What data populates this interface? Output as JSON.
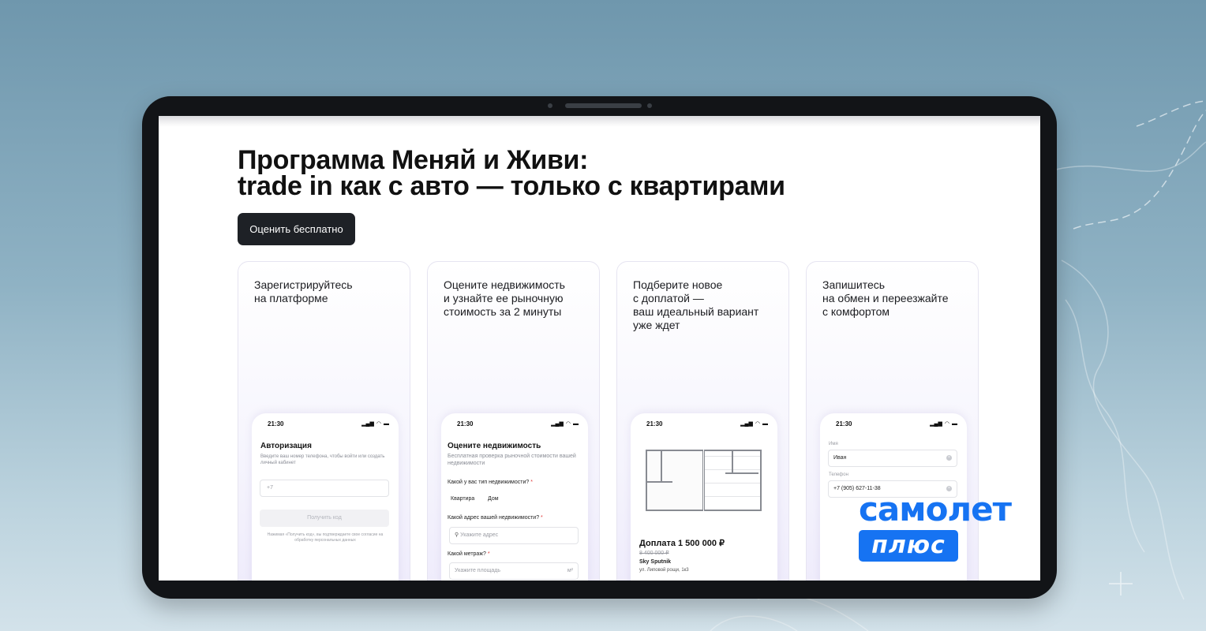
{
  "page": {
    "title_line1": "Программа Меняй и Живи:",
    "title_line2": "trade in как с авто — только с квартирами",
    "cta_label": "Оценить бесплатно"
  },
  "cards": [
    {
      "lines": [
        "Зарегистрируйтесь",
        "на платформе"
      ]
    },
    {
      "lines": [
        "Оцените недвижимость",
        "и узнайте ее рыночную",
        "стоимость за 2 минуты"
      ]
    },
    {
      "lines": [
        "Подберите новое",
        "с доплатой —",
        "ваш идеальный вариант",
        "уже ждет"
      ]
    },
    {
      "lines": [
        "Запишитесь",
        "на обмен и переезжайте",
        "с комфортом"
      ]
    }
  ],
  "phone_time": "21:30",
  "status_icons": [
    "signal-icon",
    "wifi-icon",
    "battery-icon"
  ],
  "phone1": {
    "heading": "Авторизация",
    "subtitle": "Введите ваш номер телефона, чтобы войти или создать личный кабинет",
    "phone_placeholder": "+7",
    "button": "Получить код",
    "legal": "Нажимая «Получить код», вы подтверждаете свое согласие на обработку персональных данных"
  },
  "phone2": {
    "heading": "Оцените недвижимость",
    "subtitle": "Бесплатная проверка рыночной стоимости вашей недвижимости",
    "q_type": "Какой у вас тип недвижимости?",
    "opt1": "Квартира",
    "opt2": "Дом",
    "q_addr": "Какой адрес вашей недвижимости?",
    "addr_placeholder": "Укажите адрес",
    "q_area": "Какой метраж?",
    "area_placeholder": "Укажите площадь",
    "area_unit": "м²",
    "required_mark": "*"
  },
  "phone3": {
    "price": "Доплата 1 500 000 ₽",
    "old_price": "8 400 000 ₽",
    "project": "Sky Sputnik",
    "address": "ул. Липовой рощи, 1к3"
  },
  "phone4": {
    "name_label": "Имя",
    "name_value": "Иван",
    "phone_label": "Телефон",
    "phone_value": "+7 (905) 627-11-38"
  },
  "brand": {
    "word": "самолет",
    "plus": "плюс",
    "color": "#1673f2"
  }
}
